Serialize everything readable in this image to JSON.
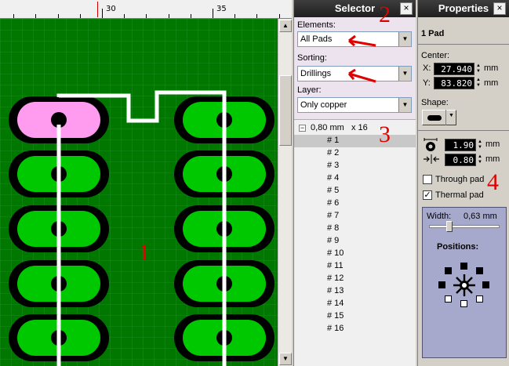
{
  "ruler": {
    "labels": [
      "30",
      "35"
    ]
  },
  "annotations": [
    "1",
    "2",
    "3",
    "4"
  ],
  "selector": {
    "title": "Selector",
    "close": "×",
    "elements_label": "Elements:",
    "elements_value": "All Pads",
    "sorting_label": "Sorting:",
    "sorting_value": "Drillings",
    "layer_label": "Layer:",
    "layer_value": "Only copper",
    "group": {
      "size": "0,80 mm",
      "count": "x 16"
    },
    "items": [
      "# 1",
      "# 2",
      "# 3",
      "# 4",
      "# 5",
      "# 6",
      "# 7",
      "# 8",
      "# 9",
      "# 10",
      "# 11",
      "# 12",
      "# 13",
      "# 14",
      "# 15",
      "# 16"
    ],
    "selected_index": 0
  },
  "properties": {
    "title": "Properties",
    "close": "×",
    "heading": "1 Pad",
    "center_label": "Center:",
    "x_label": "X:",
    "x_value": "27.940",
    "y_label": "Y:",
    "y_value": "83.820",
    "unit": "mm",
    "shape_label": "Shape:",
    "pad_size_value": "1.90",
    "drill_value": "0.80",
    "through_pad_label": "Through pad",
    "through_pad_checked": false,
    "thermal_pad_label": "Thermal pad",
    "thermal_pad_checked": true,
    "width_label": "Width:",
    "width_value": "0,63 mm",
    "width_slider_fraction": 0.25,
    "positions_label": "Positions:"
  },
  "colors": {
    "board": "#007800",
    "pad": "#00c800",
    "selected_pad": "#ff9cf0",
    "trace": "#ffffff",
    "annotation": "#e00000"
  }
}
